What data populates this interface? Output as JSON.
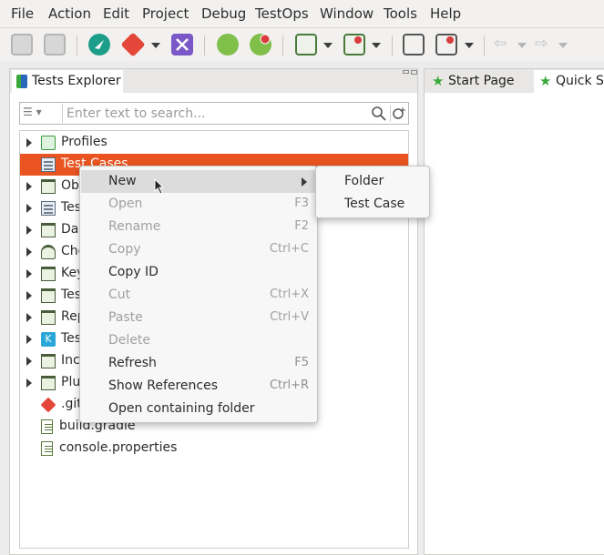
{
  "menubar": {
    "items": [
      "File",
      "Action",
      "Edit",
      "Project",
      "Debug",
      "TestOps",
      "Window",
      "Tools",
      "Help"
    ]
  },
  "colors": {
    "selection": "#e95420",
    "accent_green": "#3aa83a",
    "katalon_teal": "#1d9e8a",
    "git_red": "#e4473a",
    "katalon_purple": "#7b58c8"
  },
  "toolbar": {
    "icons": [
      "save-icon",
      "save-all-icon",
      "katalon-studio-icon",
      "git-icon",
      "katalon-recorder-icon",
      "web-spy-icon",
      "web-record-icon",
      "mobile-spy-icon",
      "mobile-record-icon",
      "windows-spy-icon",
      "windows-record-icon",
      "back-icon",
      "forward-icon"
    ]
  },
  "left_panel": {
    "tab_title": "Tests Explorer",
    "search_placeholder": "Enter text to search...",
    "tree": [
      {
        "label": "Profiles",
        "icon": "profile-icon",
        "expandable": true
      },
      {
        "label": "Test Cases",
        "icon": "test-cases-icon",
        "expandable": false,
        "selected": true
      },
      {
        "label": "Ob",
        "icon": "object-repository-icon",
        "expandable": true
      },
      {
        "label": "Tes",
        "icon": "test-suites-icon",
        "expandable": true
      },
      {
        "label": "Da",
        "icon": "data-files-icon",
        "expandable": true
      },
      {
        "label": "Che",
        "icon": "checkpoints-icon",
        "expandable": true
      },
      {
        "label": "Key",
        "icon": "keywords-icon",
        "expandable": true
      },
      {
        "label": "Tes",
        "icon": "folder-icon",
        "expandable": true
      },
      {
        "label": "Rep",
        "icon": "reports-icon",
        "expandable": true
      },
      {
        "label": "Tes",
        "icon": "katalon-icon",
        "expandable": true
      },
      {
        "label": "Inc",
        "icon": "folder-icon",
        "expandable": true
      },
      {
        "label": "Plu",
        "icon": "folder-icon",
        "expandable": true
      },
      {
        "label": ".git",
        "icon": "git-icon",
        "expandable": false
      },
      {
        "label": "build.gradle",
        "icon": "file-icon",
        "expandable": false
      },
      {
        "label": "console.properties",
        "icon": "file-icon",
        "expandable": false
      }
    ]
  },
  "right_panel": {
    "tabs": [
      "Start Page",
      "Quick St"
    ]
  },
  "context_menu": {
    "items": [
      {
        "label": "New",
        "shortcut": "",
        "disabled": false,
        "submenu": true,
        "hover": true
      },
      {
        "label": "Open",
        "shortcut": "F3",
        "disabled": true
      },
      {
        "label": "Rename",
        "shortcut": "F2",
        "disabled": true
      },
      {
        "label": "Copy",
        "shortcut": "Ctrl+C",
        "disabled": true
      },
      {
        "label": "Copy ID",
        "shortcut": "",
        "disabled": false
      },
      {
        "label": "Cut",
        "shortcut": "Ctrl+X",
        "disabled": true
      },
      {
        "label": "Paste",
        "shortcut": "Ctrl+V",
        "disabled": true
      },
      {
        "label": "Delete",
        "shortcut": "",
        "disabled": true
      },
      {
        "label": "Refresh",
        "shortcut": "F5",
        "disabled": false
      },
      {
        "label": "Show References",
        "shortcut": "Ctrl+R",
        "disabled": false
      },
      {
        "label": "Open containing folder",
        "shortcut": "",
        "disabled": false
      }
    ]
  },
  "submenu": {
    "items": [
      "Folder",
      "Test Case"
    ]
  }
}
